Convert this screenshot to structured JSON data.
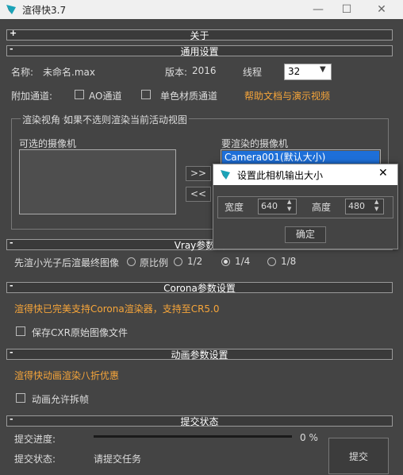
{
  "window": {
    "title": "渲得快3.7"
  },
  "rollouts": {
    "about": "关于",
    "general": "通用设置",
    "vray": "Vray参数设",
    "corona": "Corona参数设置",
    "animation": "动画参数设置",
    "submit_status": "提交状态"
  },
  "general": {
    "name_label": "名称:",
    "name_value": "未命名.max",
    "version_label": "版本:",
    "version_value": "2016",
    "threads_label": "线程",
    "threads_value": "32",
    "aux_channels_label": "附加通道:",
    "ao_channel": "AO通道",
    "mono_material_channel": "单色材质通道",
    "help_link": "帮助文档与演示视频"
  },
  "render_view": {
    "group_label": "渲染视角",
    "group_hint": "如果不选则渲染当前活动视图",
    "available_label": "可选的摄像机",
    "selected_label": "要渲染的摄像机",
    "selected_items": [
      "Camera001(默认大小)"
    ],
    "move_right": ">>",
    "move_left": "<<"
  },
  "vray": {
    "small_preview_label": "先渲小光子后渲最终图像",
    "options": [
      "原比例",
      "1/2",
      "1/4",
      "1/8"
    ],
    "selected_index": 2
  },
  "corona": {
    "support_text": "渲得快已完美支持Corona渲染器，支持至CR5.0",
    "keep_cxr": "保存CXR原始图像文件"
  },
  "animation": {
    "discount_text": "渲得快动画渲染八折优惠",
    "allow_split": "动画允许拆帧"
  },
  "submit": {
    "progress_label": "提交进度:",
    "progress_percent": 0,
    "progress_text": "0 %",
    "status_label": "提交状态:",
    "status_value": "请提交任务",
    "submit_button": "提交"
  },
  "dialog": {
    "title": "设置此相机输出大小",
    "width_label": "宽度",
    "width_value": "640",
    "height_label": "高度",
    "height_value": "480",
    "ok_button": "确定",
    "close_glyph": "✕"
  },
  "colors": {
    "accent_orange": "#f6a53a",
    "selection_blue": "#1e6fd8"
  }
}
